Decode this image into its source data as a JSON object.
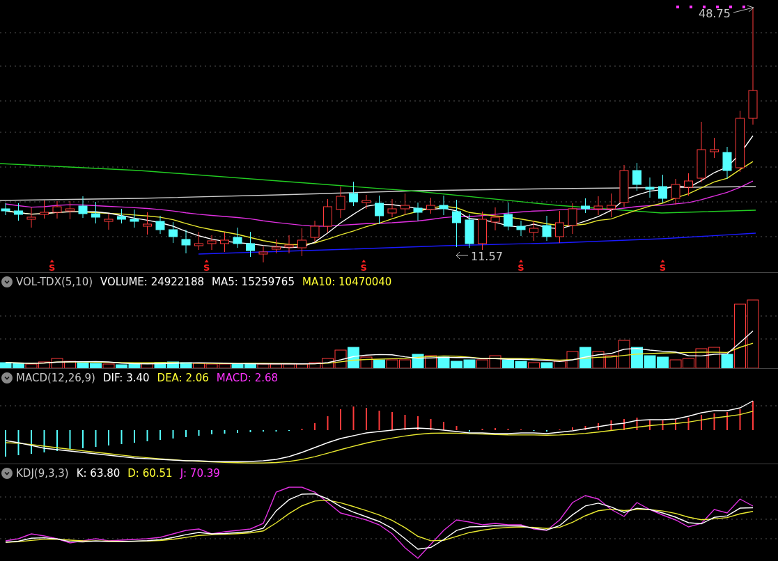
{
  "main_chart": {
    "high_label": "48.75",
    "low_label": "11.57",
    "signal_markers": [
      {
        "label": "S"
      },
      {
        "label": "S"
      },
      {
        "label": "S"
      },
      {
        "label": "S"
      },
      {
        "label": "S"
      }
    ]
  },
  "indicators": [
    {
      "kind": "volume",
      "name": "VOL-TDX(5,10)",
      "readouts": [
        {
          "text": "VOLUME: 24922188",
          "color": "#ffffff"
        },
        {
          "text": "MA5: 15259765",
          "color": "#ffffff"
        },
        {
          "text": "MA10: 10470040",
          "color": "#ffff33"
        }
      ]
    },
    {
      "kind": "macd",
      "name": "MACD(12,26,9)",
      "readouts": [
        {
          "text": "DIF: 3.40",
          "color": "#ffffff"
        },
        {
          "text": "DEA: 2.06",
          "color": "#ffff33"
        },
        {
          "text": "MACD: 2.68",
          "color": "#ff33ff"
        }
      ]
    },
    {
      "kind": "kdj",
      "name": "KDJ(9,3,3)",
      "readouts": [
        {
          "text": "K: 63.80",
          "color": "#ffffff"
        },
        {
          "text": "D: 60.51",
          "color": "#ffff33"
        },
        {
          "text": "J: 70.39",
          "color": "#ff33ff"
        }
      ]
    }
  ]
}
